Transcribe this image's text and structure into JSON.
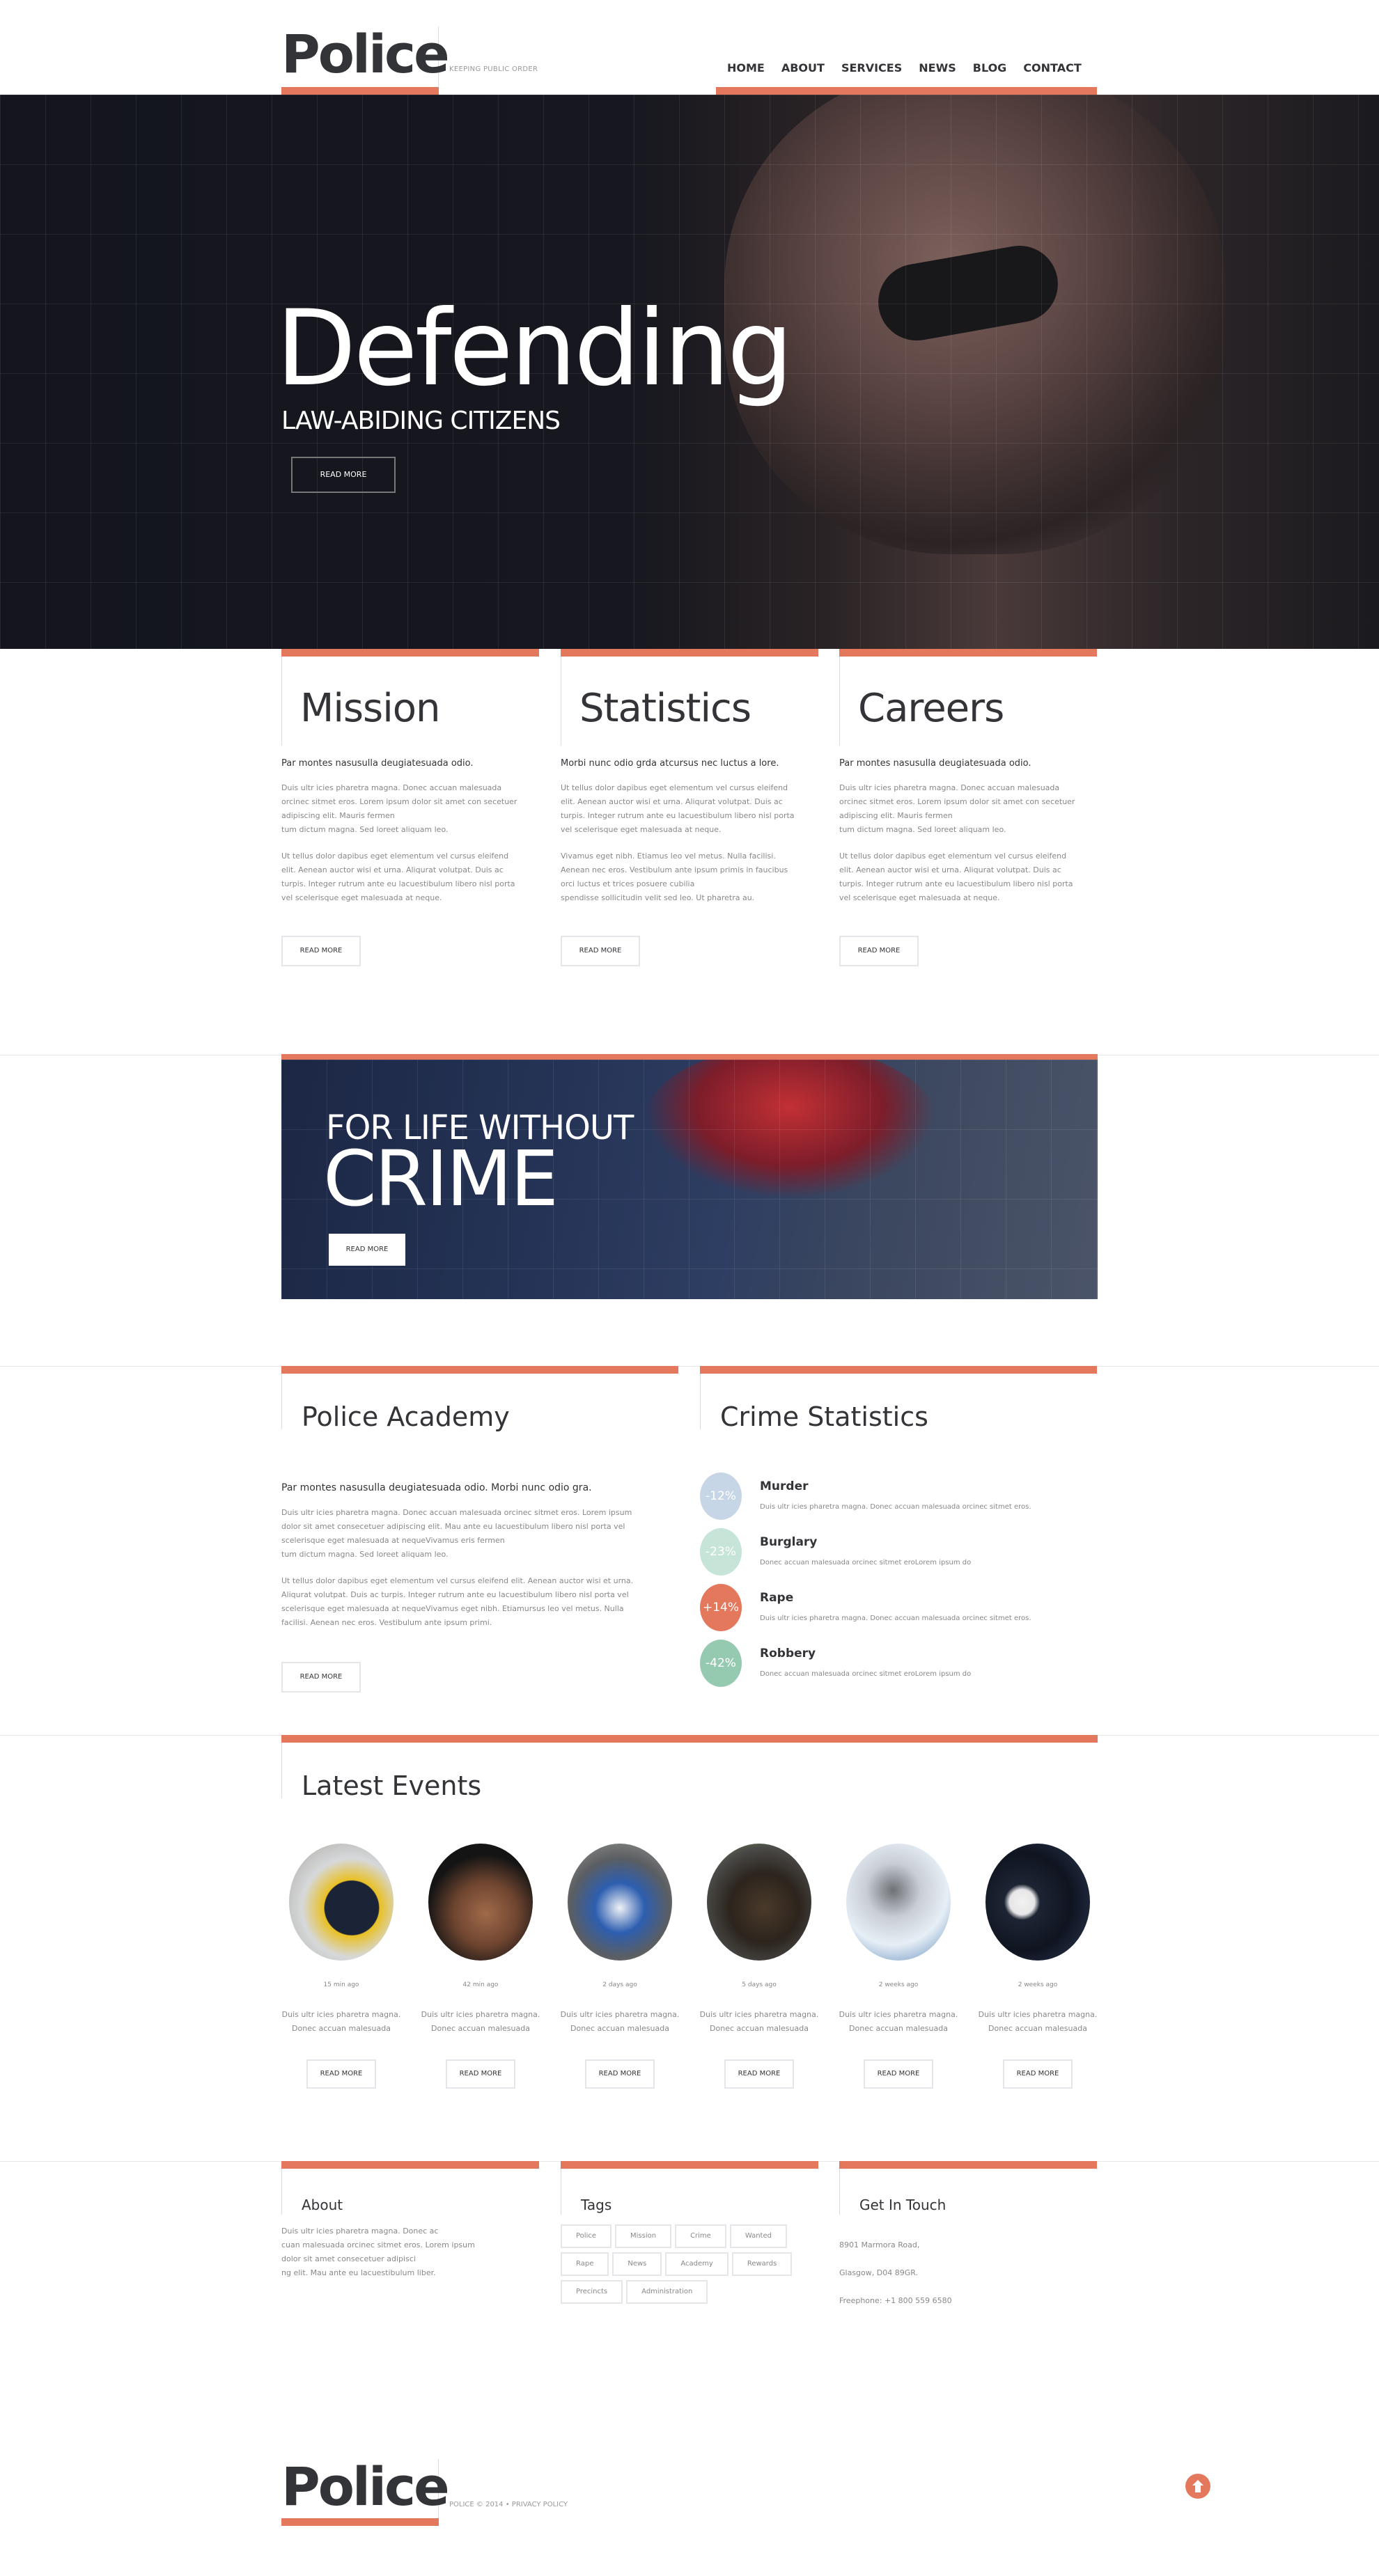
{
  "brand": {
    "name": "Police",
    "tagline": "KEEPING PUBLIC ORDER",
    "accent": "#e4785c"
  },
  "nav": {
    "items": [
      "HOME",
      "ABOUT",
      "SERVICES",
      "NEWS",
      "BLOG",
      "CONTACT"
    ],
    "active": "HOME"
  },
  "hero": {
    "title": "Defending",
    "subtitle": "LAW-ABIDING CITIZENS",
    "button": "READ MORE"
  },
  "columns": [
    {
      "title": "Mission",
      "lead": "Par montes nasusulla deugiatesuada odio.",
      "body1": "Duis ultr icies pharetra magna. Donec accuan malesuada\norcinec sitmet eros. Lorem ipsum dolor sit amet con secetuer\nadipiscing elit. Mauris fermen\ntum dictum magna. Sed loreet aliquam leo.",
      "body2": "Ut tellus dolor dapibus eget elementum vel cursus eleifend\nelit. Aenean auctor wisi et urna. Aliqurat volutpat. Duis ac\nturpis. Integer rutrum ante eu lacuestibulum libero nisl porta\nvel scelerisque eget malesuada at neque.",
      "button": "READ MORE"
    },
    {
      "title": "Statistics",
      "lead": "Morbi nunc odio grda atcursus nec luctus a lore.",
      "body1": "Ut tellus dolor dapibus eget elementum vel cursus eleifend\nelit. Aenean auctor wisi et urna. Aliqurat volutpat. Duis ac\nturpis. Integer rutrum ante eu lacuestibulum libero nisl porta\nvel scelerisque eget malesuada at neque.",
      "body2": " Vivamus eget nibh. Etiamus leo vel metus. Nulla facilisi.\nAenean nec eros. Vestibulum ante ipsum primis in faucibus\norci luctus et trices posuere cubilia\nspendisse sollicitudin velit sed leo. Ut pharetra au.",
      "button": "READ MORE"
    },
    {
      "title": "Careers",
      "lead": "Par montes nasusulla deugiatesuada odio.",
      "body1": "Duis ultr icies pharetra magna. Donec accuan malesuada\norcinec sitmet eros. Lorem ipsum dolor sit amet con secetuer\nadipiscing elit. Mauris fermen\ntum dictum magna. Sed loreet aliquam leo.",
      "body2": "Ut tellus dolor dapibus eget elementum vel cursus eleifend\nelit. Aenean auctor wisi et urna. Aliqurat volutpat. Duis ac\nturpis. Integer rutrum ante eu lacuestibulum libero nisl porta\nvel scelerisque eget malesuada at neque.",
      "button": "READ MORE"
    }
  ],
  "banner": {
    "line1": "FOR LIFE WITHOUT",
    "line2": "CRIME",
    "button": "READ MORE"
  },
  "academy": {
    "title": "Police Academy",
    "lead": "Par montes nasusulla deugiatesuada odio. Morbi nunc odio gra.",
    "body1": "Duis ultr icies pharetra magna. Donec accuan malesuada orcinec sitmet eros. Lorem ipsum\ndolor sit amet consecetuer adipiscing elit. Mau ante eu lacuestibulum libero nisl porta vel\nscelerisque eget malesuada at nequeVivamus eris fermen\ntum dictum magna. Sed loreet aliquam leo.",
    "body2": "Ut tellus dolor dapibus eget elementum vel cursus eleifend elit. Aenean auctor wisi et urna.\nAliqurat volutpat. Duis ac turpis. Integer rutrum ante eu lacuestibulum libero nisl porta vel\nscelerisque eget malesuada at nequeVivamus eget nibh. Etiamursus leo vel metus. Nulla\nfacilisi. Aenean nec eros. Vestibulum ante ipsum primi.",
    "button": "READ MORE"
  },
  "crime_stats": {
    "title": "Crime Statistics",
    "items": [
      {
        "value": "-12%",
        "name": "Murder",
        "desc": "Duis ultr icies pharetra magna. Donec accuan malesuada orcinec sitmet eros.",
        "color": "#c6d6e6"
      },
      {
        "value": "-23%",
        "name": "Burglary",
        "desc": "Donec accuan malesuada orcinec sitmet eroLorem ipsum do",
        "color": "#c6e4d8"
      },
      {
        "value": "+14%",
        "name": "Rape",
        "desc": "Duis ultr icies pharetra magna. Donec accuan malesuada orcinec sitmet eros.",
        "color": "#e4785c"
      },
      {
        "value": "-42%",
        "name": "Robbery",
        "desc": "Donec accuan malesuada orcinec sitmet eroLorem ipsum do",
        "color": "#96cab0"
      }
    ]
  },
  "events": {
    "title": "Latest Events",
    "items": [
      {
        "image": "police-helicopter",
        "time": "15 min ago",
        "desc1": "Duis ultr icies pharetra magna.",
        "desc2": "Donec accuan malesuada",
        "button": "READ MORE"
      },
      {
        "image": "handcuffs",
        "time": "42 min ago",
        "desc1": "Duis ultr icies pharetra magna.",
        "desc2": "Donec accuan malesuada",
        "button": "READ MORE"
      },
      {
        "image": "police-motorcycles",
        "time": "2 days ago",
        "desc1": "Duis ultr icies pharetra magna.",
        "desc2": "Donec accuan malesuada",
        "button": "READ MORE"
      },
      {
        "image": "police-dog",
        "time": "5 days ago",
        "desc1": "Duis ultr icies pharetra magna.",
        "desc2": "Donec accuan malesuada",
        "button": "READ MORE"
      },
      {
        "image": "security-camera",
        "time": "2 weeks ago",
        "desc1": "Duis ultr icies pharetra magna.",
        "desc2": "Donec accuan malesuada",
        "button": "READ MORE"
      },
      {
        "image": "riot-police",
        "time": "2 weeks ago",
        "desc1": "Duis ultr icies pharetra magna.",
        "desc2": "Donec accuan malesuada",
        "button": "READ MORE"
      }
    ]
  },
  "footer": {
    "about": {
      "title": "About",
      "body": "Duis ultr icies pharetra magna. Donec ac\ncuan malesuada orcinec sitmet eros. Lorem ipsum\ndolor sit amet consecetuer adipisci\nng elit. Mau ante eu lacuestibulum liber."
    },
    "tags": {
      "title": "Tags",
      "items": [
        "Police",
        "Mission",
        "Crime",
        "Wanted",
        "Rape",
        "News",
        "Academy",
        "Rewards",
        "Precincts",
        "Administration"
      ]
    },
    "contact": {
      "title": "Get In Touch",
      "address1": "8901 Marmora Road,",
      "address2": "Glasgow, D04 89GR.",
      "phone": "Freephone:  +1 800 559 6580"
    },
    "copyright": "POLICE © 2014 •",
    "privacy": "PRIVACY POLICY",
    "to_top_icon": "arrow-up-circle-icon"
  }
}
